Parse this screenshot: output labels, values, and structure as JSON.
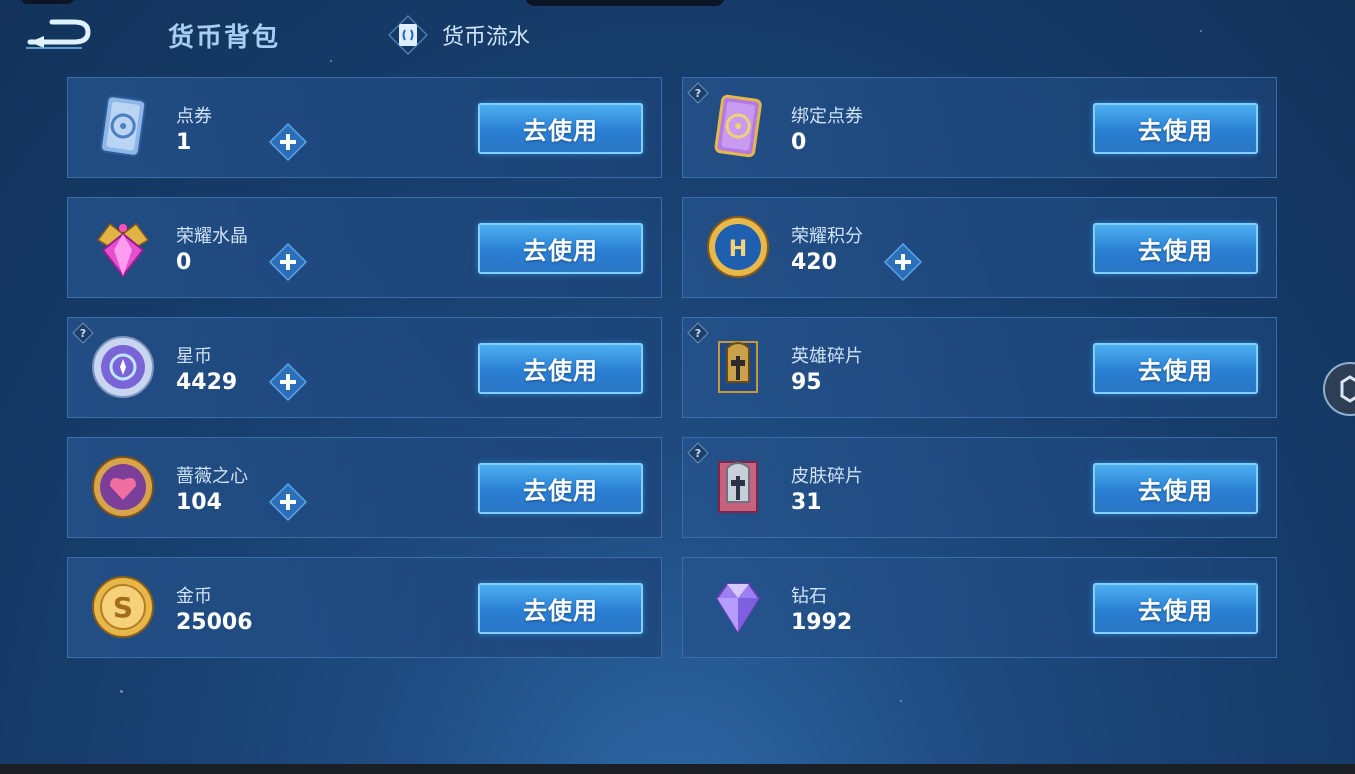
{
  "header": {
    "title": "货币背包",
    "flow_label": "货币流水"
  },
  "colors": {
    "background": "#173e6d",
    "button": "#2a7fd4",
    "plus": "#3e8ad6"
  },
  "currencies": [
    {
      "name": "点券",
      "count": "1",
      "has_plus": true,
      "has_help": false,
      "icon": "coupon-ticket-icon",
      "button": "去使用"
    },
    {
      "name": "绑定点券",
      "count": "0",
      "has_plus": false,
      "has_help": true,
      "icon": "bound-coupon-ticket-icon",
      "button": "去使用"
    },
    {
      "name": "荣耀水晶",
      "count": "0",
      "has_plus": true,
      "has_help": false,
      "icon": "glory-crystal-icon",
      "button": "去使用"
    },
    {
      "name": "荣耀积分",
      "count": "420",
      "has_plus": true,
      "has_help": false,
      "icon": "glory-points-icon",
      "button": "去使用"
    },
    {
      "name": "星币",
      "count": "4429",
      "has_plus": true,
      "has_help": true,
      "icon": "star-coin-icon",
      "button": "去使用"
    },
    {
      "name": "英雄碎片",
      "count": "95",
      "has_plus": false,
      "has_help": true,
      "icon": "hero-fragment-icon",
      "button": "去使用"
    },
    {
      "name": "蔷薇之心",
      "count": "104",
      "has_plus": true,
      "has_help": false,
      "icon": "rose-heart-icon",
      "button": "去使用"
    },
    {
      "name": "皮肤碎片",
      "count": "31",
      "has_plus": false,
      "has_help": true,
      "icon": "skin-fragment-icon",
      "button": "去使用"
    },
    {
      "name": "金币",
      "count": "25006",
      "has_plus": false,
      "has_help": false,
      "icon": "gold-coin-icon",
      "button": "去使用"
    },
    {
      "name": "钻石",
      "count": "1992",
      "has_plus": false,
      "has_help": false,
      "icon": "diamond-icon",
      "button": "去使用"
    }
  ]
}
